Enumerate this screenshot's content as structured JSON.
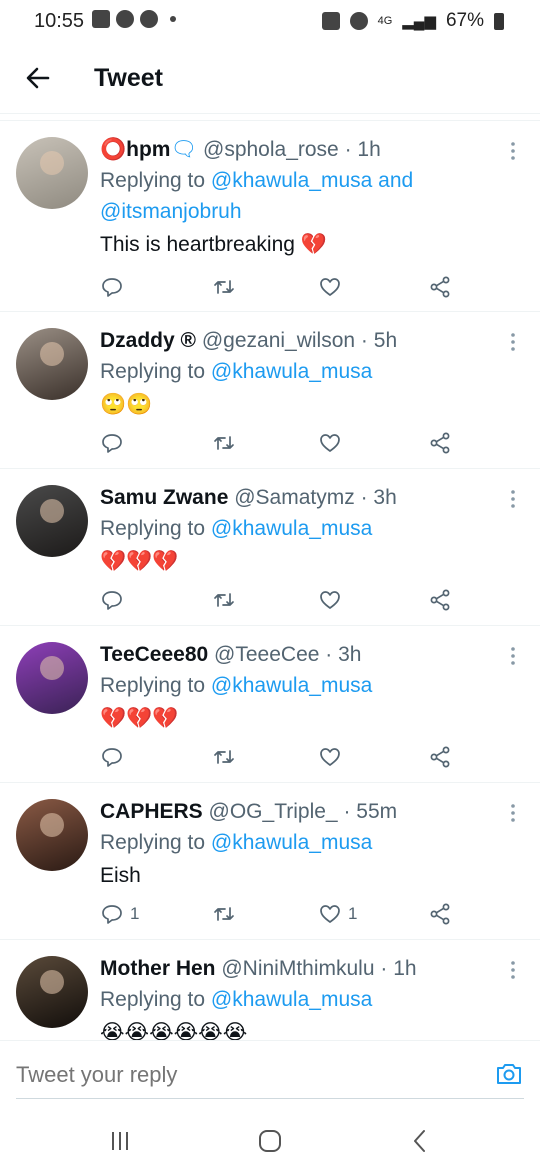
{
  "status_bar": {
    "time": "10:55",
    "network": "4G",
    "battery": "67%"
  },
  "header": {
    "title": "Tweet"
  },
  "tweets": [
    {
      "name_prefix": "⭕",
      "name": "hpm",
      "name_suffix": "🗨",
      "handle": "@sphola_rose",
      "time": "1h",
      "replying_label": "Replying to",
      "mention1": "@khawula_musa",
      "joiner": "and",
      "mention2": "@itsmanjobruh",
      "text": "This is heartbreaking 💔",
      "reply_count": "",
      "like_count": ""
    },
    {
      "name": "Dzaddy ®",
      "handle": "@gezani_wilson",
      "time": "5h",
      "replying_label": "Replying to",
      "mention1": "@khawula_musa",
      "text": "🙄🙄",
      "reply_count": "",
      "like_count": ""
    },
    {
      "name": "Samu Zwane",
      "handle": "@Samatymz",
      "time": "3h",
      "replying_label": "Replying to",
      "mention1": "@khawula_musa",
      "text": "💔💔💔",
      "reply_count": "",
      "like_count": ""
    },
    {
      "name": "TeeCeee80",
      "handle": "@TeeeCee",
      "time": "3h",
      "replying_label": "Replying to",
      "mention1": "@khawula_musa",
      "text": "💔💔💔",
      "reply_count": "",
      "like_count": ""
    },
    {
      "name": "CAPHERS",
      "handle": "@OG_Triple_",
      "time": "55m",
      "replying_label": "Replying to",
      "mention1": "@khawula_musa",
      "text": "Eish",
      "reply_count": "1",
      "like_count": "1"
    },
    {
      "name": "Mother Hen",
      "handle": "@NiniMthimkulu",
      "time": "1h",
      "replying_label": "Replying to",
      "mention1": "@khawula_musa",
      "text": "😭😭😭😭😭😭",
      "reply_count": "",
      "like_count": ""
    }
  ],
  "reply_bar": {
    "placeholder": "Tweet your reply"
  },
  "icons": {
    "back": "arrow-left-icon",
    "more": "more-vertical-icon",
    "reply": "speech-bubble-icon",
    "retweet": "retweet-icon",
    "like": "heart-icon",
    "share": "share-icon",
    "camera": "camera-icon",
    "recents": "recents-icon",
    "home": "home-icon",
    "nav_back": "chevron-left-icon"
  },
  "colors": {
    "accent": "#1d9bf0",
    "text_primary": "#0f1419",
    "text_secondary": "#536471"
  }
}
